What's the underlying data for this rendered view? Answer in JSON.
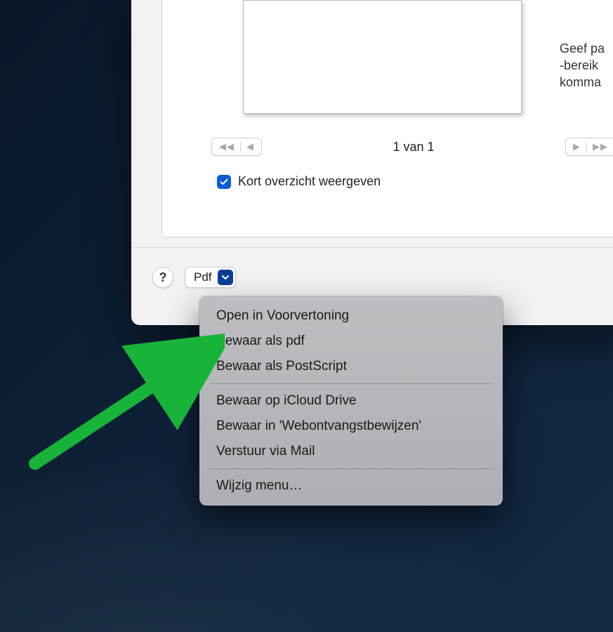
{
  "preview": {
    "page_label": "1 van 1",
    "side_hint": "Geef pa\n-bereik\nkomma"
  },
  "checkbox": {
    "label": "Kort overzicht weergeven",
    "checked": true
  },
  "footer": {
    "help_label": "?",
    "pdf_button_label": "Pdf"
  },
  "menu": {
    "items_group1": [
      "Open in Voorvertoning",
      "Bewaar als pdf",
      "Bewaar als PostScript"
    ],
    "items_group2": [
      "Bewaar op iCloud Drive",
      "Bewaar in 'Webontvangstbewijzen'",
      "Verstuur via Mail"
    ],
    "items_group3": [
      "Wijzig menu…"
    ]
  },
  "colors": {
    "accent": "#0a5dd6",
    "arrow": "#18b43a"
  }
}
